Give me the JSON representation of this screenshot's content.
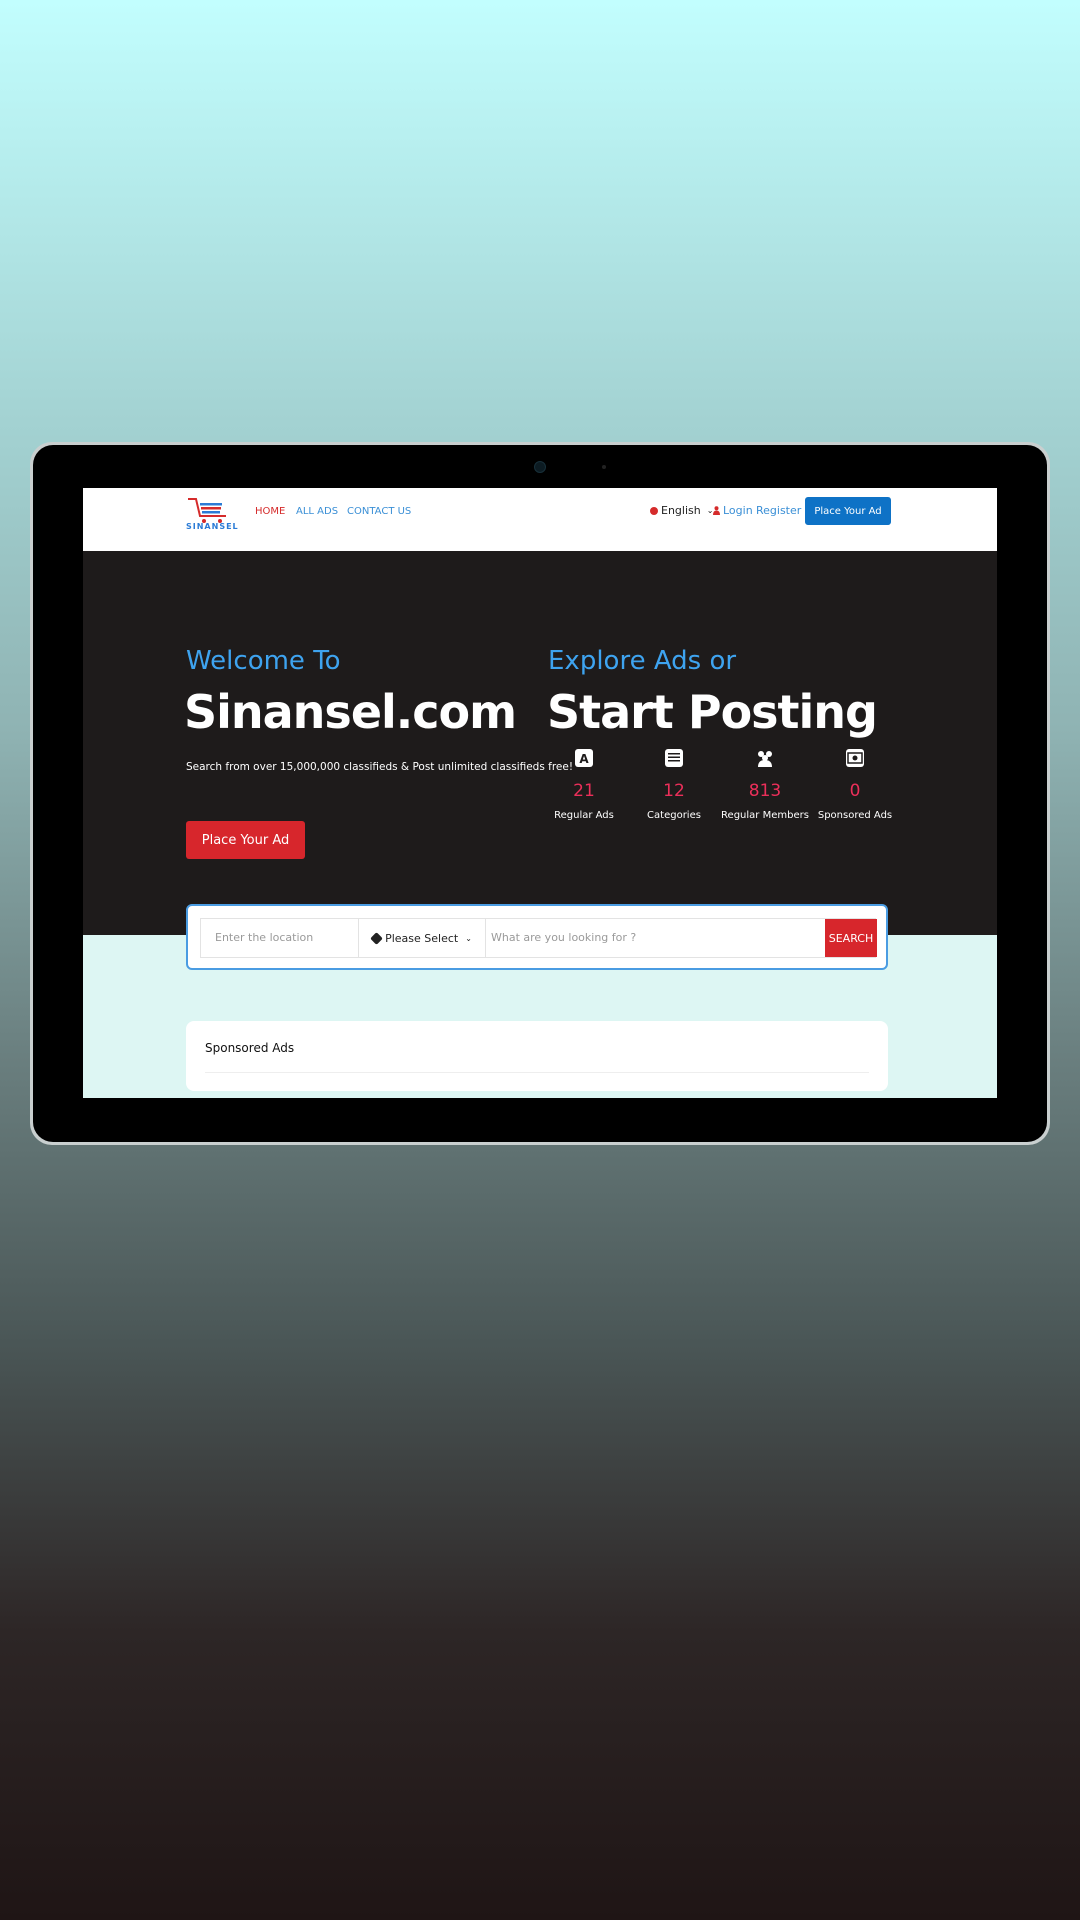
{
  "site": {
    "logo_text": "SINANSEL",
    "nav": [
      "HOME",
      "ALL ADS",
      "CONTACT US"
    ],
    "language": "English",
    "login": "Login",
    "register": "Register",
    "place_ad": "Place Your Ad"
  },
  "hero": {
    "welcome": "Welcome To",
    "brand": "Sinansel.com",
    "tagline": "Search from over 15,000,000 classifieds & Post unlimited classifieds free!",
    "cta": "Place Your Ad",
    "explore": "Explore Ads or",
    "start": "Start Posting",
    "stats": [
      {
        "value": "21",
        "label": "Regular Ads",
        "icon": "ad-icon"
      },
      {
        "value": "12",
        "label": "Categories",
        "icon": "list-icon"
      },
      {
        "value": "813",
        "label": "Regular Members",
        "icon": "users-icon"
      },
      {
        "value": "0",
        "label": "Sponsored Ads",
        "icon": "money-icon"
      }
    ]
  },
  "search": {
    "location_placeholder": "Enter the location",
    "category": "Please Select",
    "query_placeholder": "What are you looking for ?",
    "button": "SEARCH"
  },
  "sponsored": {
    "title": "Sponsored Ads"
  },
  "colors": {
    "accent_red": "#d7262c",
    "accent_blue": "#0e72c6",
    "link_blue": "#3a8fd6",
    "hero_bg": "#1e1b1b",
    "stat_red": "#ec2f5a"
  }
}
